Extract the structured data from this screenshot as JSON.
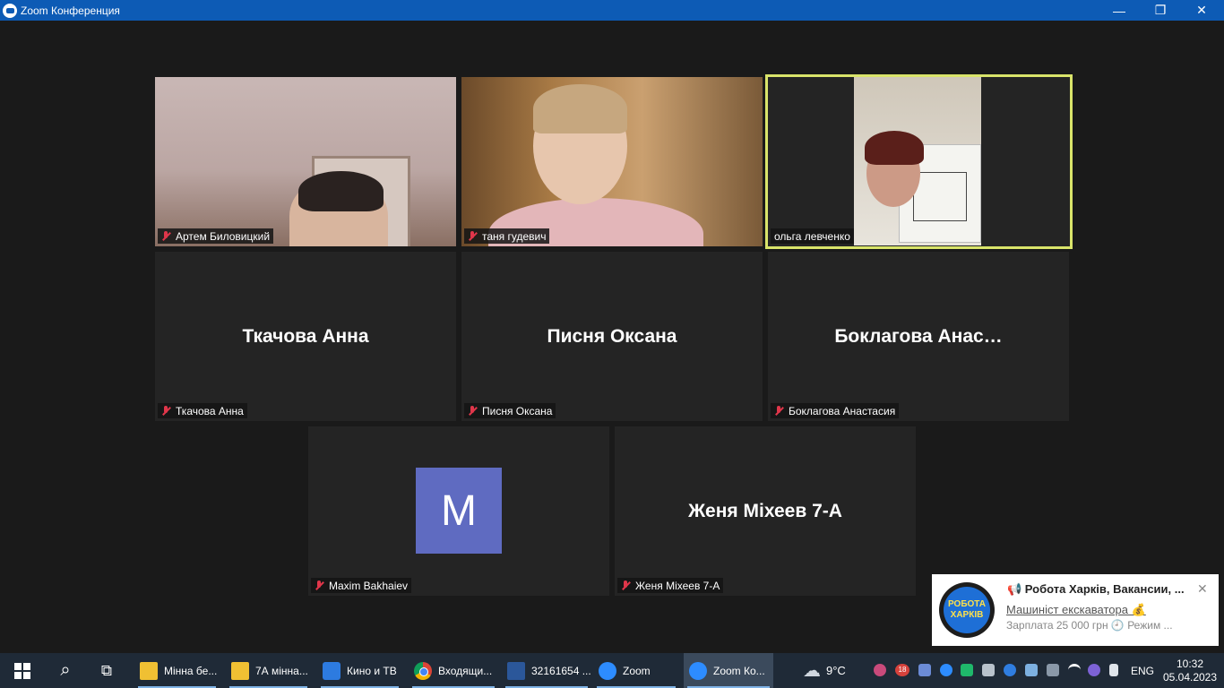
{
  "window": {
    "title": "Zoom Конференция",
    "minimize_glyph": "—",
    "maximize_glyph": "❐",
    "close_glyph": "✕"
  },
  "participants": {
    "video": [
      {
        "name": "Артем Биловицкий"
      },
      {
        "name": "таня гудевич"
      },
      {
        "name": "ольга левченко",
        "active_speaker": true
      }
    ],
    "named": [
      {
        "display": "Ткачова Анна",
        "label": "Ткачова Анна"
      },
      {
        "display": "Писня Оксана",
        "label": "Писня Оксана"
      },
      {
        "display": "Боклагова  Анас…",
        "label": "Боклагова Анастасия"
      }
    ],
    "bottom": [
      {
        "avatar_letter": "M",
        "label": "Maxim Bakhaiev"
      },
      {
        "display": "Женя Міхеев 7-А",
        "label": "Женя Міхеев 7-А"
      }
    ]
  },
  "notification": {
    "logo_line1": "РОБОТА",
    "logo_line2": "ХАРКІВ",
    "title": "📢 Робота Харків, Вакансии, ...",
    "subtitle": "Машиніст екскаватора 💰",
    "body": "Зарплата 25 000 грн 🕘 Режим ...",
    "close_glyph": "✕"
  },
  "taskbar": {
    "search_glyph": "⌕",
    "taskview_glyph": "⧉",
    "apps": [
      {
        "label": "Мінна бе...",
        "icon": "folder-icon"
      },
      {
        "label": "7А мінна...",
        "icon": "folder-icon"
      },
      {
        "label": "Кино и ТВ",
        "icon": "film-icon"
      },
      {
        "label": "Входящи...",
        "icon": "chrome-icon"
      },
      {
        "label": "32161654 ...",
        "icon": "word-icon"
      },
      {
        "label": "Zoom",
        "icon": "zoom-icon"
      },
      {
        "label": "Zoom Ко...",
        "icon": "zoom-icon"
      }
    ],
    "weather": {
      "temp": "9°C",
      "glyph": "☁"
    },
    "tray_badge": "18",
    "language": "ENG",
    "time": "10:32",
    "date": "05.04.2023"
  },
  "colors": {
    "titlebar": "#0d5bb5",
    "active_speaker_border": "#d9e46a",
    "muted_mic": "#e0364a",
    "avatar_bg": "#5f6bc1"
  }
}
